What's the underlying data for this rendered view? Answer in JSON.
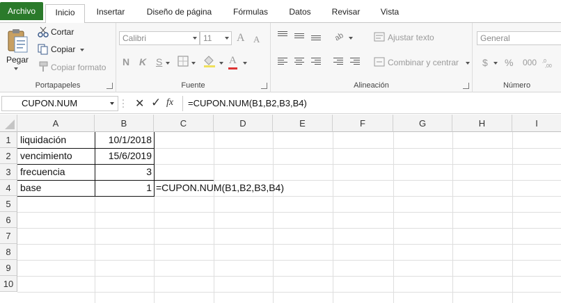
{
  "tabs": [
    {
      "label": "Archivo"
    },
    {
      "label": "Inicio"
    },
    {
      "label": "Insertar"
    },
    {
      "label": "Diseño de página"
    },
    {
      "label": "Fórmulas"
    },
    {
      "label": "Datos"
    },
    {
      "label": "Revisar"
    },
    {
      "label": "Vista"
    }
  ],
  "ribbon": {
    "clipboard": {
      "paste_label": "Pegar",
      "cut_label": "Cortar",
      "copy_label": "Copiar",
      "format_painter_label": "Copiar formato",
      "group_label": "Portapapeles"
    },
    "font": {
      "font_name": "Calibri",
      "font_size": "11",
      "bold": "N",
      "italic": "K",
      "underline": "S",
      "grow": "A",
      "shrink": "A",
      "font_color_glyph": "A",
      "group_label": "Fuente"
    },
    "alignment": {
      "wrap_label": "Ajustar texto",
      "merge_label": "Combinar y centrar",
      "group_label": "Alineación"
    },
    "number": {
      "format": "General",
      "currency": "$",
      "percent": "%",
      "thousands": "000",
      "group_label": "Número"
    }
  },
  "formula_bar": {
    "name_box": "CUPON.NUM",
    "cancel": "✕",
    "enter": "✓",
    "fx": "fx",
    "formula": "=CUPON.NUM(B1,B2,B3,B4)"
  },
  "sheet": {
    "columns": [
      "A",
      "B",
      "C",
      "D",
      "E",
      "F",
      "G",
      "H",
      "I"
    ],
    "rows": [
      "1",
      "2",
      "3",
      "4",
      "5",
      "6",
      "7",
      "8",
      "9",
      "10"
    ],
    "cells": {
      "A1": "liquidación",
      "B1": "10/1/2018",
      "A2": "vencimiento",
      "B2": "15/6/2019",
      "A3": "frecuencia",
      "B3": "3",
      "A4": "base",
      "B4": "1",
      "C4": "=CUPON.NUM(B1,B2,B3,B4)"
    }
  },
  "colors": {
    "file_tab": "#2b7a2b",
    "ribbon_bg": "#f7f7f7",
    "header_bg": "#f3f3f3"
  }
}
